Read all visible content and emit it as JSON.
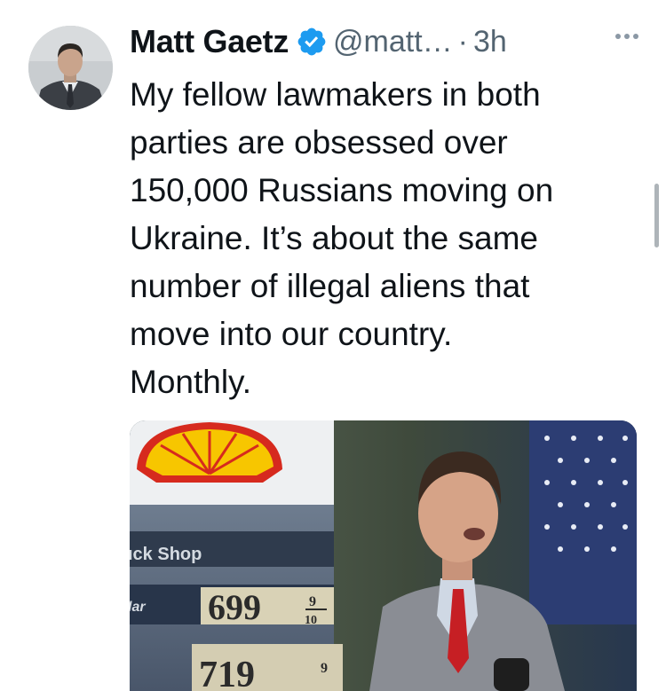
{
  "tweet": {
    "author_name": "Matt Gaetz",
    "handle": "@matt…",
    "separator": "·",
    "time": "3h",
    "text": "My fellow lawmakers in both\nparties are obsessed over\n150,000 Russians moving on\nUkraine. It’s about the same\nnumber of illegal aliens that\nmove into our country.\nMonthly.",
    "avatar_icon": "profile-photo",
    "verified_icon": "verified-badge-icon",
    "more_icon": "more-options-icon"
  },
  "media": {
    "sign_text_1": "ıck Shop",
    "sign_text_2": "lar",
    "price_1_main": "699",
    "price_1_frac_top": "9",
    "price_1_frac_bottom": "10",
    "price_2_main": "719",
    "price_2_frac_top": "9"
  },
  "colors": {
    "verified_blue": "#1d9bf0",
    "text": "#0f1419",
    "secondary": "#536471",
    "shell_yellow": "#f7c600",
    "shell_red": "#d62a1e"
  }
}
